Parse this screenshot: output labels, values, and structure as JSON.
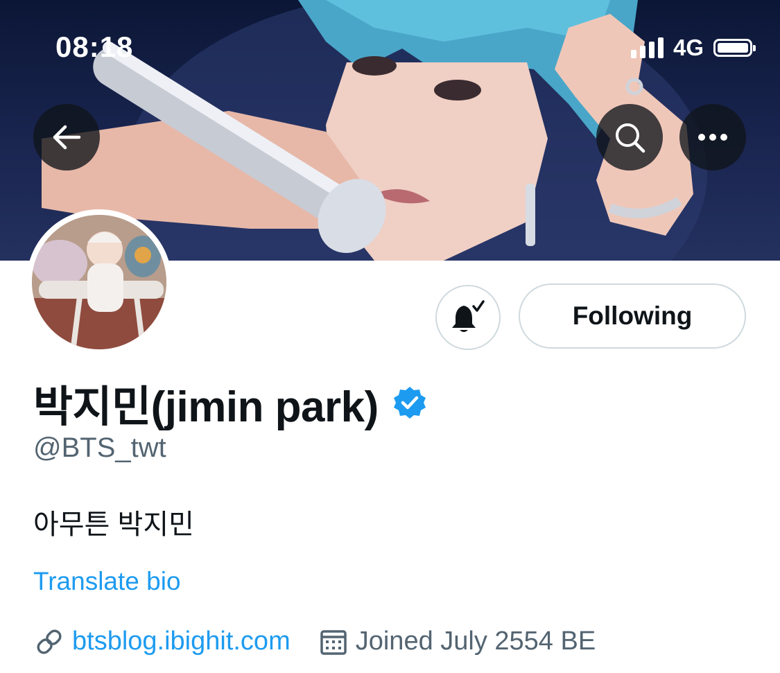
{
  "status_bar": {
    "time": "08:18",
    "network": "4G"
  },
  "header": {
    "back_icon": "arrow-left-icon",
    "search_icon": "search-icon",
    "more_icon": "more-horizontal-icon"
  },
  "actions": {
    "notification_icon": "bell-check-icon",
    "follow_label": "Following"
  },
  "profile": {
    "display_name": "박지민(jimin park)",
    "verified": true,
    "handle": "@BTS_twt",
    "bio": "아무튼 박지민",
    "translate_label": "Translate bio",
    "website": "btsblog.ibighit.com",
    "joined": "Joined July 2554 BE"
  },
  "colors": {
    "accent": "#1d9bf0",
    "text_primary": "#0f1419",
    "text_secondary": "#536471",
    "border": "#cfd9de"
  }
}
